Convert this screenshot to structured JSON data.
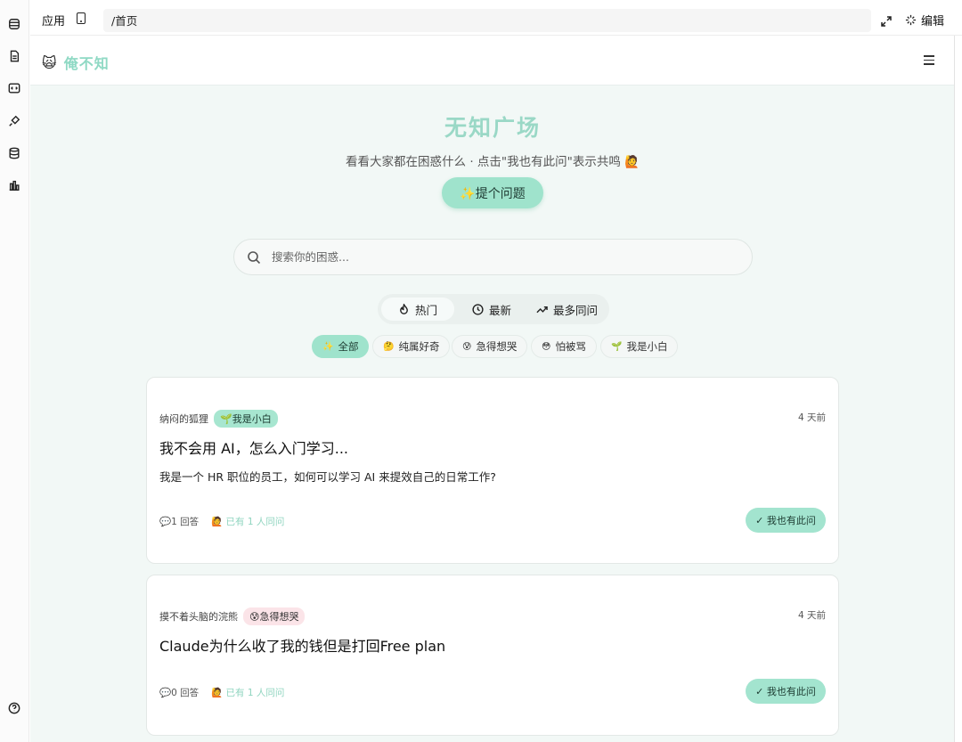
{
  "topbar": {
    "app_label": "应用",
    "path": "/首页",
    "edit_label": "编辑"
  },
  "app": {
    "logo_emoji": "🙀",
    "brand_name": "俺不知"
  },
  "hero": {
    "title": "无知广场",
    "subtitle": "看看大家都在困惑什么 · 点击\"我也有此问\"表示共鸣 🙋",
    "ask_button": "✨提个问题"
  },
  "search": {
    "placeholder": "搜索你的困惑..."
  },
  "sort_tabs": [
    {
      "label": "热门",
      "icon": "flame-icon",
      "active": true
    },
    {
      "label": "最新",
      "icon": "clock-icon",
      "active": false
    },
    {
      "label": "最多同问",
      "icon": "trending-up-icon",
      "active": false
    }
  ],
  "categories": [
    {
      "emoji": "✨",
      "label": "全部",
      "active": true
    },
    {
      "emoji": "🤔",
      "label": "纯属好奇",
      "active": false
    },
    {
      "emoji": "😰",
      "label": "急得想哭",
      "active": false
    },
    {
      "emoji": "😳",
      "label": "怕被骂",
      "active": false
    },
    {
      "emoji": "🌱",
      "label": "我是小白",
      "active": false
    }
  ],
  "questions": [
    {
      "author": "纳闷的狐狸",
      "tag": "🌱我是小白",
      "tag_style": "green",
      "time": "4 天前",
      "title": "我不会用 AI，怎么入门学习...",
      "body": "我是一个 HR 职位的员工，如何可以学习 AI 来提效自己的日常工作?",
      "answers": "💬1 回答",
      "same_count": "🙋 已有 1 人同问",
      "same_button": "✓ 我也有此问"
    },
    {
      "author": "摸不着头脑的浣熊",
      "tag": "😰急得想哭",
      "tag_style": "pink",
      "time": "4 天前",
      "title": "Claude为什么收了我的钱但是打回Free plan",
      "body": "",
      "answers": "💬0 回答",
      "same_count": "🙋 已有 1 人同问",
      "same_button": "✓ 我也有此问"
    }
  ],
  "colors": {
    "accent": "#9fe3cc",
    "brand_text": "#8fd9c4",
    "page_bg": "#f2f8f6"
  }
}
